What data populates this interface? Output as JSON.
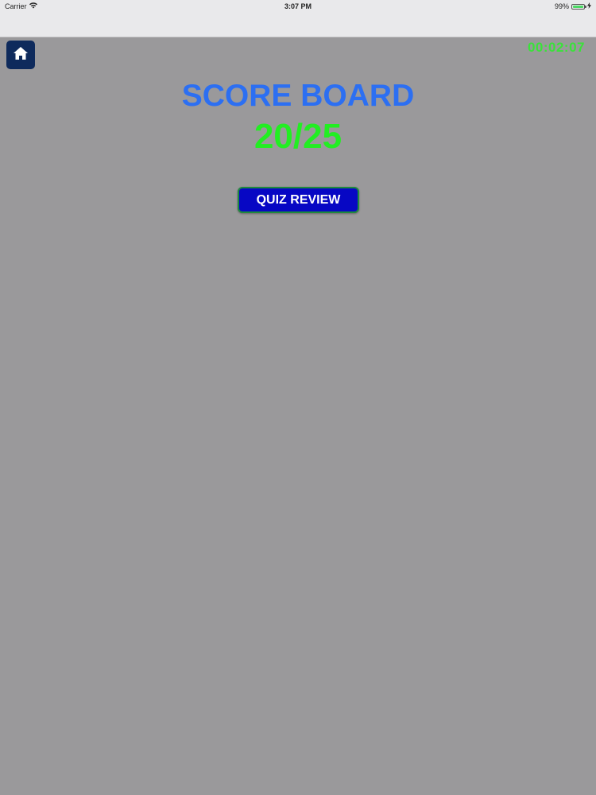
{
  "status_bar": {
    "carrier": "Carrier",
    "time": "3:07 PM",
    "battery": "99%",
    "battery_level": 0.99
  },
  "header": {
    "home_icon": "home-icon",
    "timer": "00:02:07"
  },
  "scoreboard": {
    "title": "SCORE BOARD",
    "score": "20/25",
    "review_label": "QUIZ REVIEW"
  },
  "colors": {
    "background": "#9a999b",
    "title": "#2c6ff2",
    "score": "#22ee22",
    "timer": "#3ae23a",
    "button": "#0707c4",
    "home_button": "#0e2a5c"
  }
}
